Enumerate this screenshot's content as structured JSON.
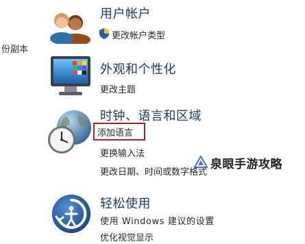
{
  "left_fragment": "份副本",
  "sections": [
    {
      "title": "用户帐户",
      "icon": "users-icon",
      "links": [
        "更改帐户类型"
      ]
    },
    {
      "title": "外观和个性化",
      "icon": "monitor-palette-icon",
      "links": [
        "更改主题"
      ]
    },
    {
      "title": "时钟、语言和区域",
      "icon": "globe-clock-icon",
      "links": [
        "添加语言",
        "更换输入法",
        "更改日期、时间或数字格式"
      ]
    },
    {
      "title": "轻松使用",
      "icon": "ease-of-access-icon",
      "links": [
        "使用 Windows 建议的设置",
        "优化视觉显示"
      ]
    }
  ],
  "watermark": {
    "text": "泉眼手游攻略",
    "icon": "triangle-logo-icon"
  },
  "colors": {
    "title": "#1e3a5f",
    "link": "#2a2a2a",
    "highlight": "#b02020"
  }
}
